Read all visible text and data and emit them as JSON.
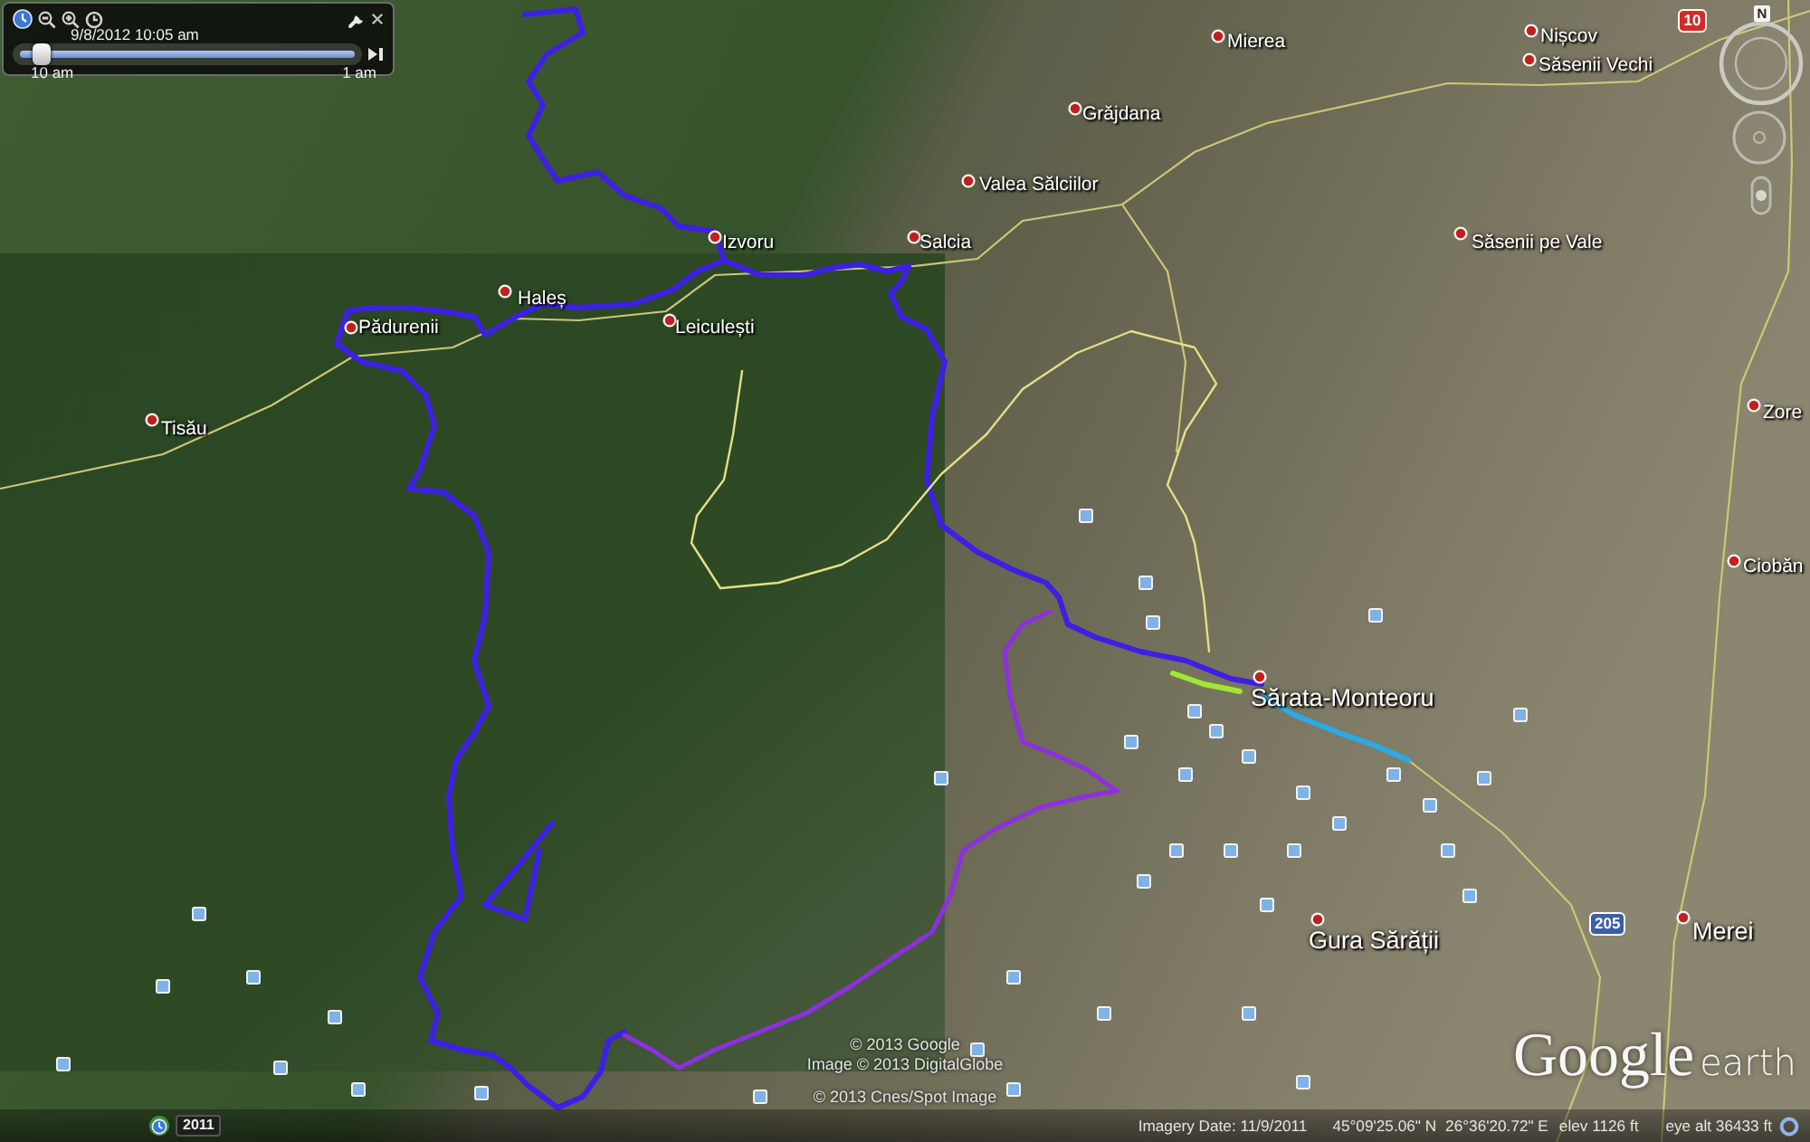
{
  "time_slider": {
    "date_time": "9/8/2012 10:05 am",
    "start_label": "10 am",
    "end_label": "1 am",
    "level": 0.06
  },
  "navigation": {
    "north": "N",
    "zoom": {
      "level": 0.5
    }
  },
  "road_shields": [
    {
      "label": "10",
      "color": "#d42a2a"
    },
    {
      "label": "205",
      "color": "#3b5ea8"
    }
  ],
  "places": [
    {
      "name": "Nișcov",
      "kind": "village"
    },
    {
      "name": "Mierea",
      "kind": "village"
    },
    {
      "name": "Săsenii Vechi",
      "kind": "village"
    },
    {
      "name": "Grăjdana",
      "kind": "village"
    },
    {
      "name": "Valea Sălciilor",
      "kind": "village"
    },
    {
      "name": "Izvoru",
      "kind": "village"
    },
    {
      "name": "Salcia",
      "kind": "village"
    },
    {
      "name": "Săsenii pe Vale",
      "kind": "village"
    },
    {
      "name": "Haleș",
      "kind": "village"
    },
    {
      "name": "Pădurenii",
      "kind": "village"
    },
    {
      "name": "Leiculești",
      "kind": "village"
    },
    {
      "name": "Zore",
      "kind": "village"
    },
    {
      "name": "Tisău",
      "kind": "village"
    },
    {
      "name": "Ciobăn",
      "kind": "village"
    },
    {
      "name": "Sărata-Monteoru",
      "kind": "town"
    },
    {
      "name": "Merei",
      "kind": "town"
    },
    {
      "name": "Gura Sărății",
      "kind": "town"
    }
  ],
  "tracks": [
    {
      "color": "#3d1fe6"
    },
    {
      "color": "#8e2fe0"
    },
    {
      "color": "#e4df86"
    },
    {
      "color": "#9fe832"
    },
    {
      "color": "#2aaae6"
    }
  ],
  "copyright": [
    "© 2013 Google",
    "Image © 2013 DigitalGlobe",
    "© 2013 Cnes/Spot Image"
  ],
  "logo": {
    "brand": "Google",
    "product": "earth"
  },
  "status_bar": {
    "historical_year": "2011",
    "imagery_date": "Imagery Date: 11/9/2011",
    "latitude": "45°09'25.06\" N",
    "longitude": "26°36'20.72\" E",
    "elevation": "elev 1126 ft",
    "eye_altitude": "eye alt 36433 ft"
  }
}
